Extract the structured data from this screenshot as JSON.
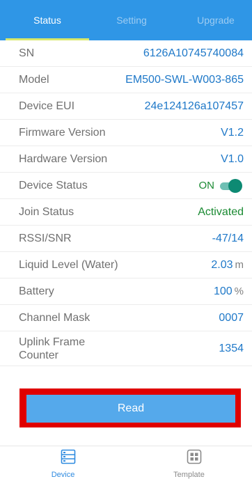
{
  "tabs": [
    {
      "label": "Status"
    },
    {
      "label": "Setting"
    },
    {
      "label": "Upgrade"
    }
  ],
  "rows": [
    {
      "label": "SN",
      "value": "6126A10745740084"
    },
    {
      "label": "Model",
      "value": "EM500-SWL-W003-865"
    },
    {
      "label": "Device EUI",
      "value": "24e124126a107457"
    },
    {
      "label": "Firmware Version",
      "value": "V1.2"
    },
    {
      "label": "Hardware Version",
      "value": "V1.0"
    },
    {
      "label": "Device Status",
      "value": "ON",
      "toggle_on": true
    },
    {
      "label": "Join Status",
      "value": "Activated"
    },
    {
      "label": "RSSI/SNR",
      "value": "-47/14"
    },
    {
      "label": "Liquid Level (Water)",
      "value": "2.03",
      "unit": "m"
    },
    {
      "label": "Battery",
      "value": "100",
      "unit": "%"
    },
    {
      "label": "Channel Mask",
      "value": "0007"
    },
    {
      "label": "Uplink Frame Counter",
      "value": "1354"
    }
  ],
  "read_button": {
    "label": "Read"
  },
  "bottom_nav": [
    {
      "label": "Device",
      "icon": "device-list-icon"
    },
    {
      "label": "Template",
      "icon": "template-grid-icon"
    }
  ],
  "colors": {
    "accent": "#2f96e6",
    "value_blue": "#1e78c8",
    "status_green": "#1a8a32",
    "toggle": "#0d8a73",
    "highlight": "#e00000"
  }
}
